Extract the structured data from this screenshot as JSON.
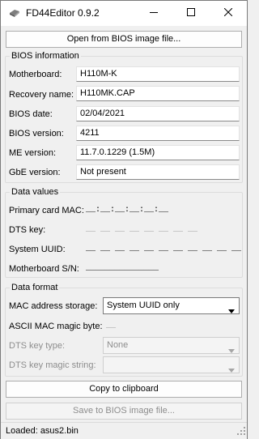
{
  "window": {
    "title": "FD44Editor 0.9.2",
    "icon": "app-icon",
    "controls": [
      "minimize-icon",
      "maximize-icon",
      "close-icon"
    ]
  },
  "buttons": {
    "open": "Open from BIOS image file...",
    "copy": "Copy to clipboard",
    "save": "Save to BIOS image file..."
  },
  "bios_info": {
    "title": "BIOS information",
    "rows": [
      {
        "label": "Motherboard:",
        "value": "H110M-K"
      },
      {
        "label": "Recovery name:",
        "value": "H110MK.CAP"
      },
      {
        "label": "BIOS date:",
        "value": "02/04/2021"
      },
      {
        "label": "BIOS version:",
        "value": "4211"
      },
      {
        "label": "ME version:",
        "value": "11.7.0.1229 (1.5M)"
      },
      {
        "label": "GbE version:",
        "value": "Not present"
      }
    ]
  },
  "data_values": {
    "title": "Data values",
    "rows": [
      {
        "label": "Primary card MAC:",
        "mask": "__:__:__:__:__:__"
      },
      {
        "label": "DTS key:",
        "mask": "__ __ __ __ __ __ __ __"
      },
      {
        "label": "System UUID:",
        "mask": "__ __ __ __ __ __ __ __ __ __ __"
      },
      {
        "label": "Motherboard S/N:",
        "mask": "_______________"
      }
    ]
  },
  "data_format": {
    "title": "Data format",
    "mac_storage": {
      "label": "MAC address storage:",
      "selected": "System UUID only"
    },
    "ascii_magic": {
      "label": "ASCII MAC magic byte:",
      "mask": "__"
    },
    "dts_key_type": {
      "label": "DTS key type:",
      "selected": "None"
    },
    "dts_magic_string": {
      "label": "DTS key magic string:",
      "selected": ""
    }
  },
  "status": {
    "text": "Loaded: asus2.bin"
  }
}
